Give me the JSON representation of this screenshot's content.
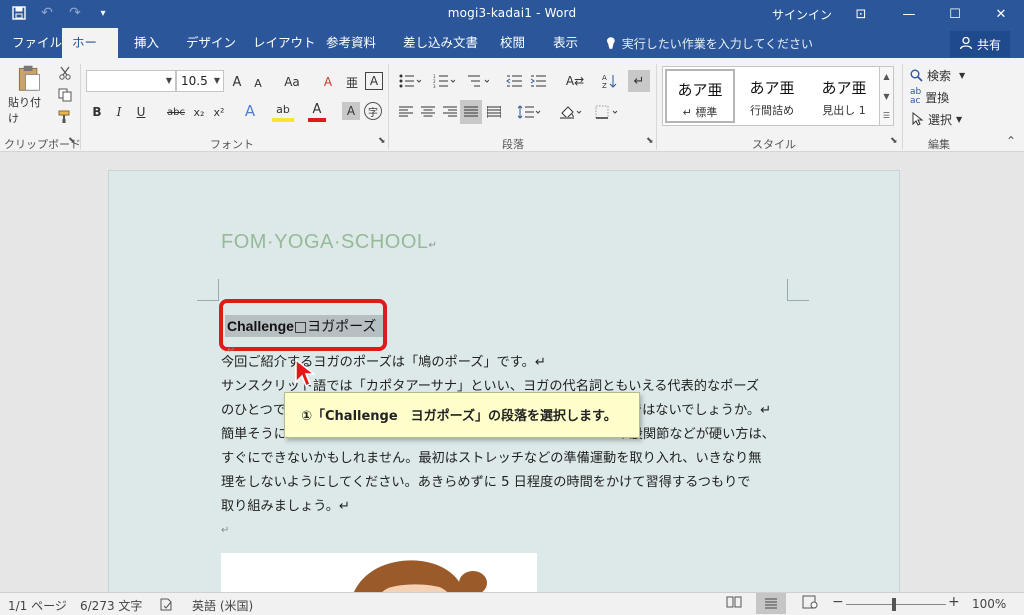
{
  "titlebar": {
    "doc_title": "mogi3-kadai1  -  Word",
    "signin": "サインイン",
    "qat": {
      "save": "💾",
      "undo": "↶",
      "redo": "↷",
      "customize": "▾"
    },
    "win": {
      "restore_ribbon": "⊡",
      "minimize": "—",
      "maximize": "☐",
      "close": "✕"
    }
  },
  "tabs": [
    {
      "label": "ファイル"
    },
    {
      "label": "ホーム"
    },
    {
      "label": "挿入"
    },
    {
      "label": "デザイン"
    },
    {
      "label": "レイアウト"
    },
    {
      "label": "参考資料"
    },
    {
      "label": "差し込み文書"
    },
    {
      "label": "校閲"
    },
    {
      "label": "表示"
    }
  ],
  "tellme": {
    "icon": "💡",
    "text": "実行したい作業を入力してください"
  },
  "share": {
    "icon": "👤",
    "label": "共有"
  },
  "ribbon": {
    "clipboard": {
      "paste": "貼り付け",
      "group": "クリップボード"
    },
    "font": {
      "name_value": "",
      "size_value": "10.5",
      "group": "フォント",
      "row1": {
        "grow": "A",
        "shrink": "A",
        "case": "Aa",
        "clear": "A",
        "phonetic": "亜",
        "border": "A"
      },
      "row2": {
        "bold": "B",
        "italic": "I",
        "underline": "U",
        "strike": "abc",
        "sub": "x₂",
        "sup": "x²",
        "effects": "A",
        "highlight": "ab",
        "color": "A",
        "shade": "A",
        "enclose": "字"
      }
    },
    "paragraph": {
      "group": "段落"
    },
    "styles": {
      "group": "スタイル",
      "items": [
        {
          "big": "あア亜",
          "small": "↵ 標準"
        },
        {
          "big": "あア亜",
          "small": "行間詰め"
        },
        {
          "big": "あア亜",
          "small": "見出し 1"
        }
      ]
    },
    "editing": {
      "group": "編集",
      "find": "検索",
      "replace": "置換",
      "select": "選択"
    }
  },
  "document": {
    "school_title": "FOM·YOGA·SCHOOL",
    "heading": "Challenge□ヨガポーズ",
    "heading_latin": "Challenge",
    "heading_jp": "□ヨガポーズ",
    "para_mark": "↵",
    "lines": [
      "今回ご紹介するヨガのポーズは「鳩のポーズ」です。↵",
      "サンスクリット語では「カポタアーサナ」といい、ヨガの代名詞ともいえる代表的なポーズ",
      "のひとつで　　　　　　　　　　　　　　　　　　　　　　　　　のではないでしょうか。↵",
      "簡単そうに　　　　　　　　　　　　　　　　　　　　　　　　　や股関節などが硬い方は、",
      "すぐにできないかもしれません。最初はストレッチなどの準備運動を取り入れ、いきなり無",
      "理をしないようにしてください。あきらめずに 5 日程度の時間をかけて習得するつもりで",
      "取り組みましょう。↵",
      "↵"
    ]
  },
  "callout": {
    "text": "①「Challenge　ヨガポーズ」の段落を選択します。"
  },
  "statusbar": {
    "page": "1/1 ページ",
    "words": "6/273 文字",
    "lang": "英語 (米国)",
    "zoom": "100%"
  },
  "colors": {
    "accent": "#2b579a",
    "highlight_box": "#e01a1a",
    "callout_bg": "#ffffcc"
  }
}
